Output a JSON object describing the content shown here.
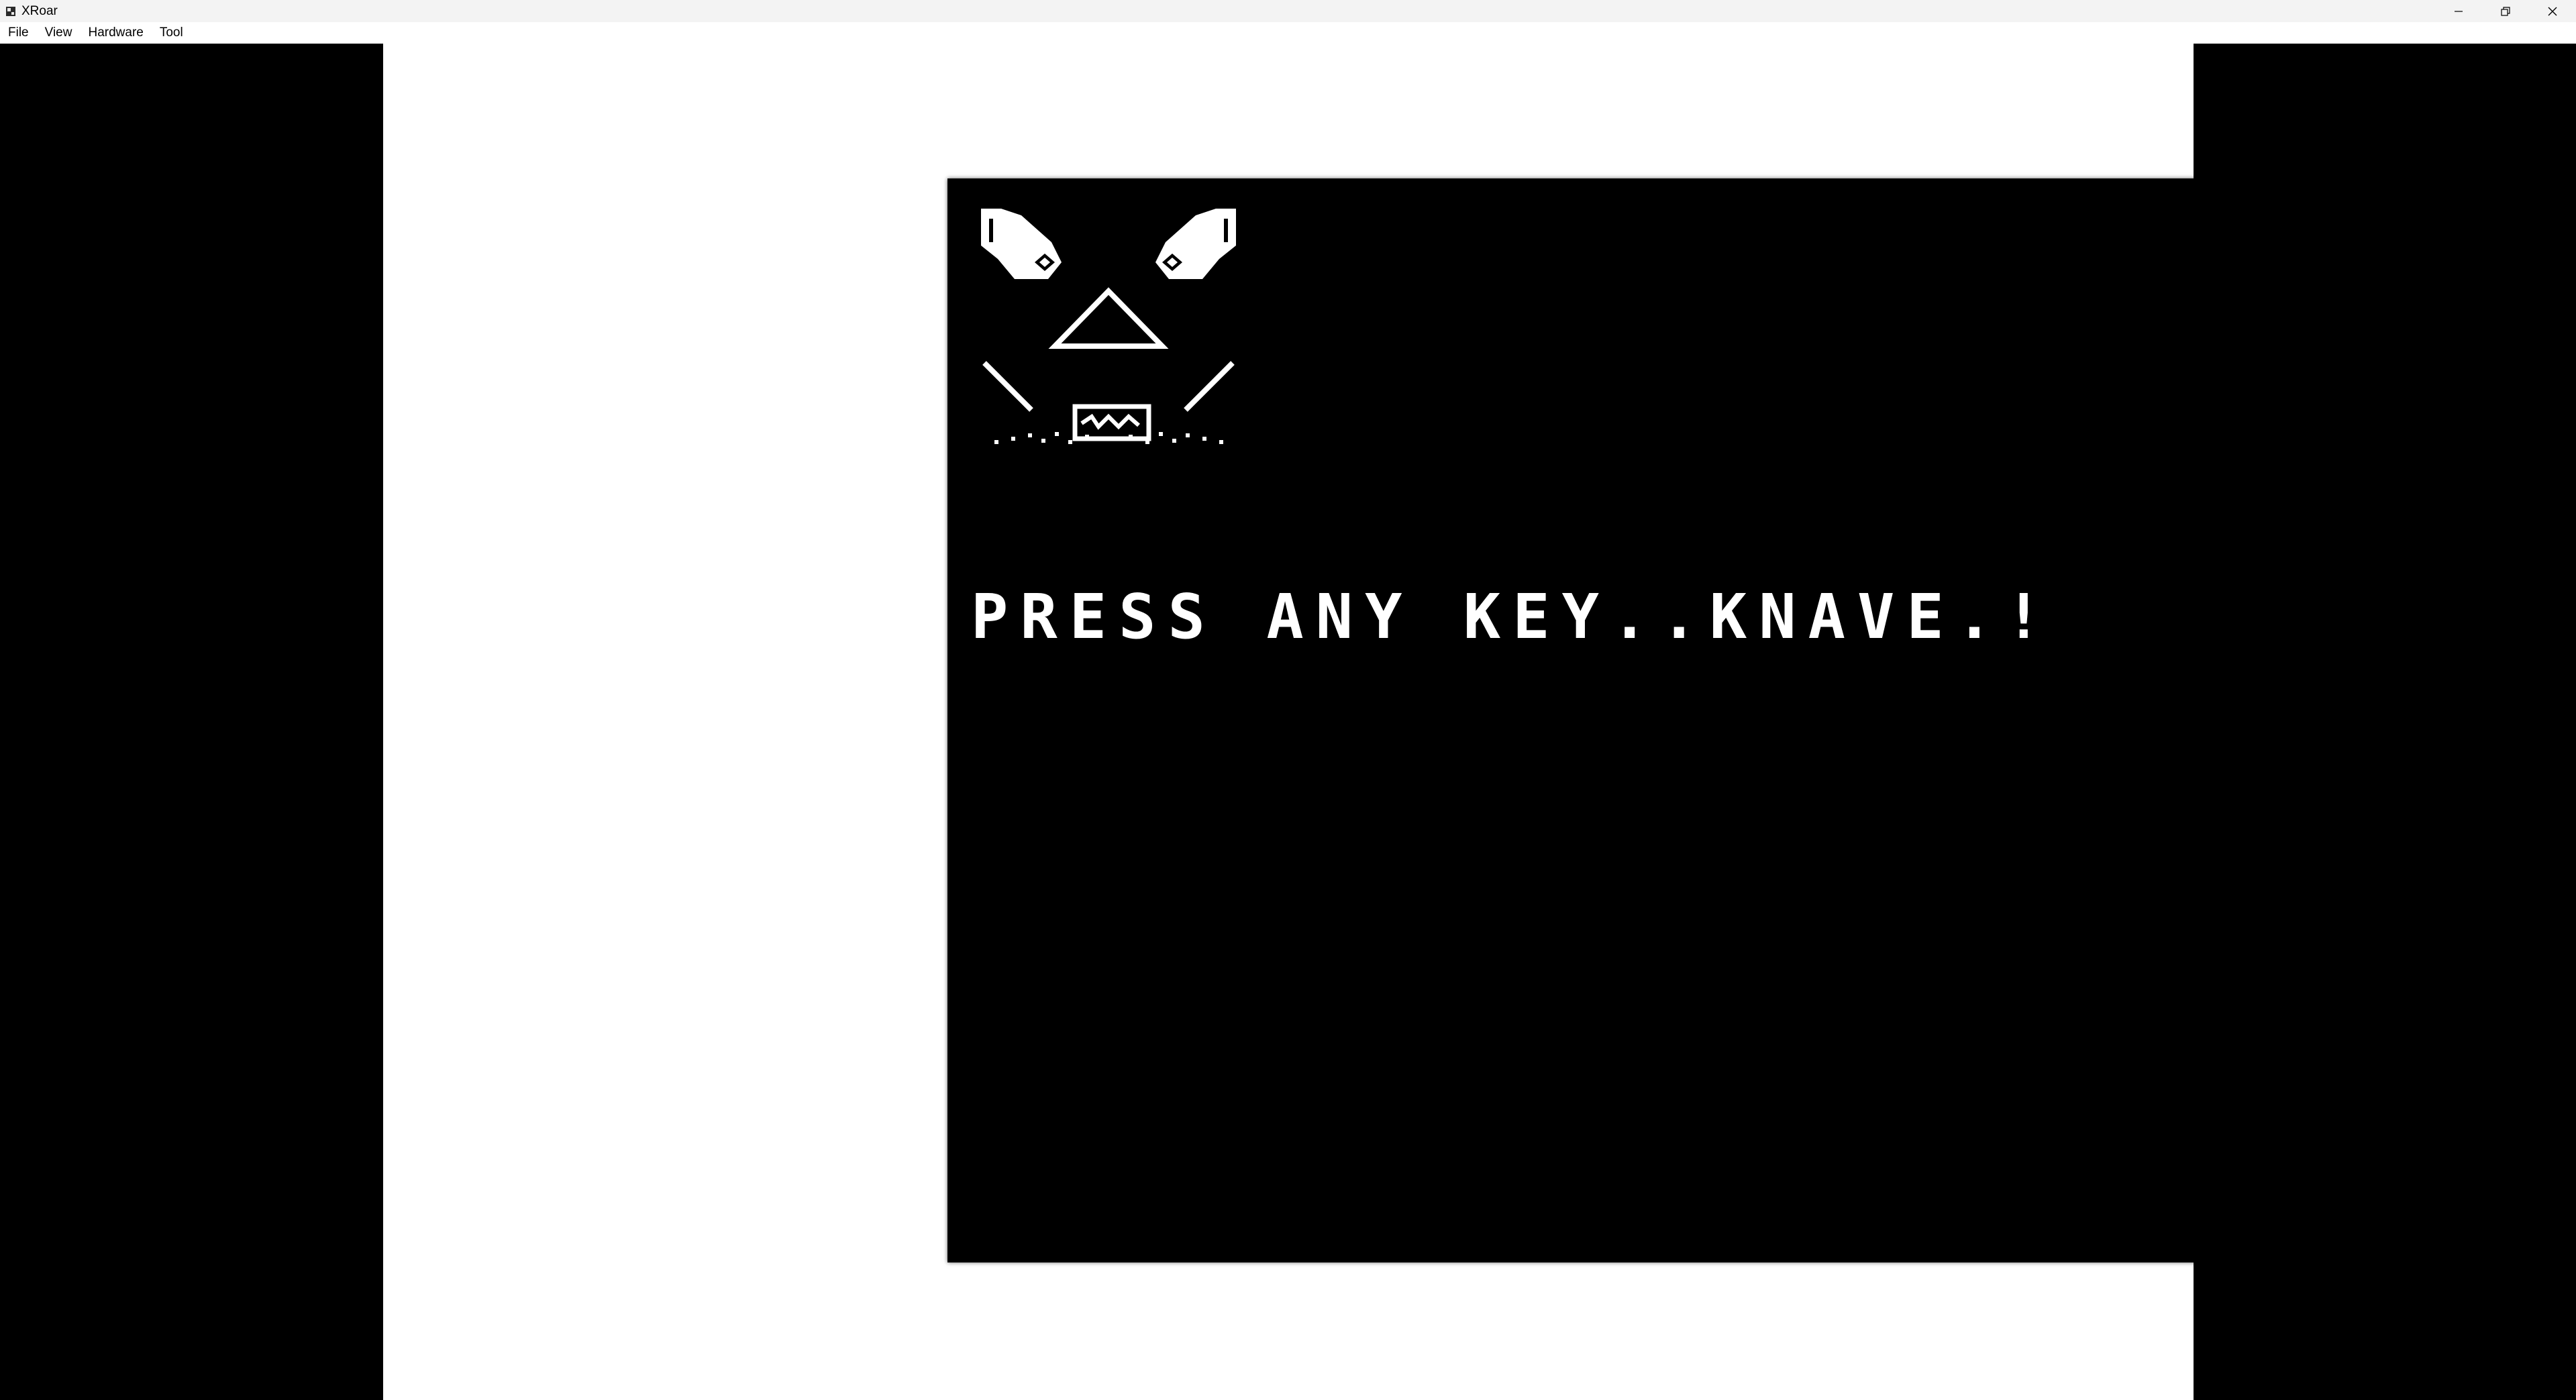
{
  "window": {
    "title": "XRoar",
    "app_icon": "xroar-app-icon"
  },
  "menu": {
    "items": [
      {
        "label": "File"
      },
      {
        "label": "View"
      },
      {
        "label": "Hardware"
      },
      {
        "label": "Tool"
      }
    ]
  },
  "emulator": {
    "screen_text": "PRESS ANY KEY..KNAVE.!",
    "logo_icon": "skull-face-icon",
    "border_color": "#ffffff",
    "screen_color": "#000000",
    "text_color": "#ffffff"
  }
}
